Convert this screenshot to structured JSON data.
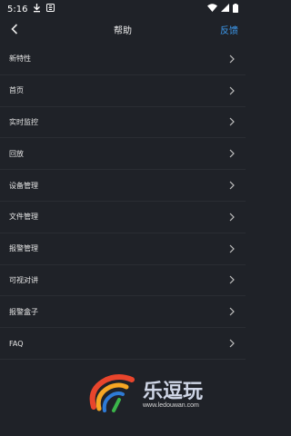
{
  "status_bar": {
    "time": "5:16"
  },
  "header": {
    "title": "帮助",
    "feedback_label": "反馈"
  },
  "menu": {
    "items": [
      {
        "label": "新特性"
      },
      {
        "label": "首页"
      },
      {
        "label": "实时监控"
      },
      {
        "label": "回放"
      },
      {
        "label": "设备管理"
      },
      {
        "label": "文件管理"
      },
      {
        "label": "报警管理"
      },
      {
        "label": "可视对讲"
      },
      {
        "label": "报警盒子"
      },
      {
        "label": "FAQ"
      }
    ]
  },
  "watermark": {
    "name": "乐逗玩",
    "url": "www.ledouwan.com"
  },
  "colors": {
    "background": "#1f2228",
    "accent": "#3d9bf0"
  }
}
